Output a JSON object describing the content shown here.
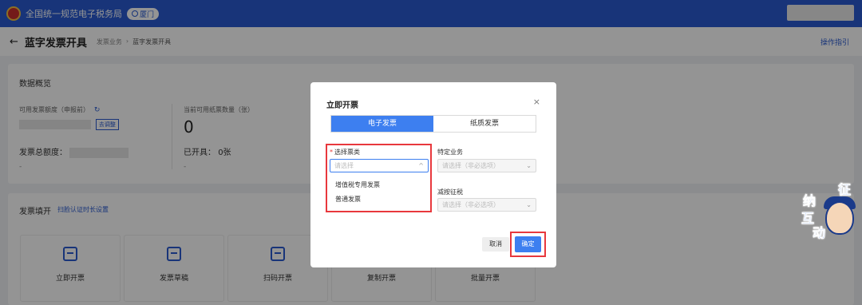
{
  "topbar": {
    "app_title": "全国统一规范电子税务局",
    "city": "厦门"
  },
  "header": {
    "page_title": "蓝字发票开具",
    "breadcrumb": [
      "发票业务",
      "蓝字发票开具"
    ],
    "help_link": "操作指引"
  },
  "overview": {
    "section_title": "数据概览",
    "available_amount_label": "可用发票额度（申报前）",
    "adjust_button": "去调整",
    "total_amount_label": "发票总额度：",
    "total_dash": "-",
    "paper_count_label": "当前可用纸票数量（张）",
    "paper_count_value": "0",
    "issued_label": "已开具：",
    "issued_value": "0张",
    "issued_dash": "-"
  },
  "fill": {
    "section_title": "发票填开",
    "link": "扫脸认证时长设置",
    "tiles": [
      {
        "label": "立即开票",
        "icon": "invoice-icon"
      },
      {
        "label": "发票草稿",
        "icon": "draft-icon"
      },
      {
        "label": "扫码开票",
        "icon": "qrcode-icon"
      },
      {
        "label": "复制开票",
        "icon": "copy-icon"
      },
      {
        "label": "批量开票",
        "icon": "batch-icon"
      }
    ]
  },
  "modal": {
    "title": "立即开票",
    "tabs": [
      "电子发票",
      "纸质发票"
    ],
    "invoice_type_label": "选择票类",
    "invoice_type_placeholder": "请选择",
    "invoice_type_options": [
      "增值税专用发票",
      "普通发票"
    ],
    "special_business_label": "特定业务",
    "special_business_placeholder": "请选择（非必选项）",
    "tax_reduction_label": "减按征税",
    "tax_reduction_placeholder": "请选择（非必选项）",
    "cancel_label": "取消",
    "confirm_label": "确定"
  },
  "mascot": {
    "chars": [
      "征",
      "纳",
      "互",
      "动"
    ]
  },
  "colors": {
    "brand_blue": "#2a5bd1",
    "tab_active": "#3d7ff0",
    "highlight_red": "#e8383d"
  }
}
